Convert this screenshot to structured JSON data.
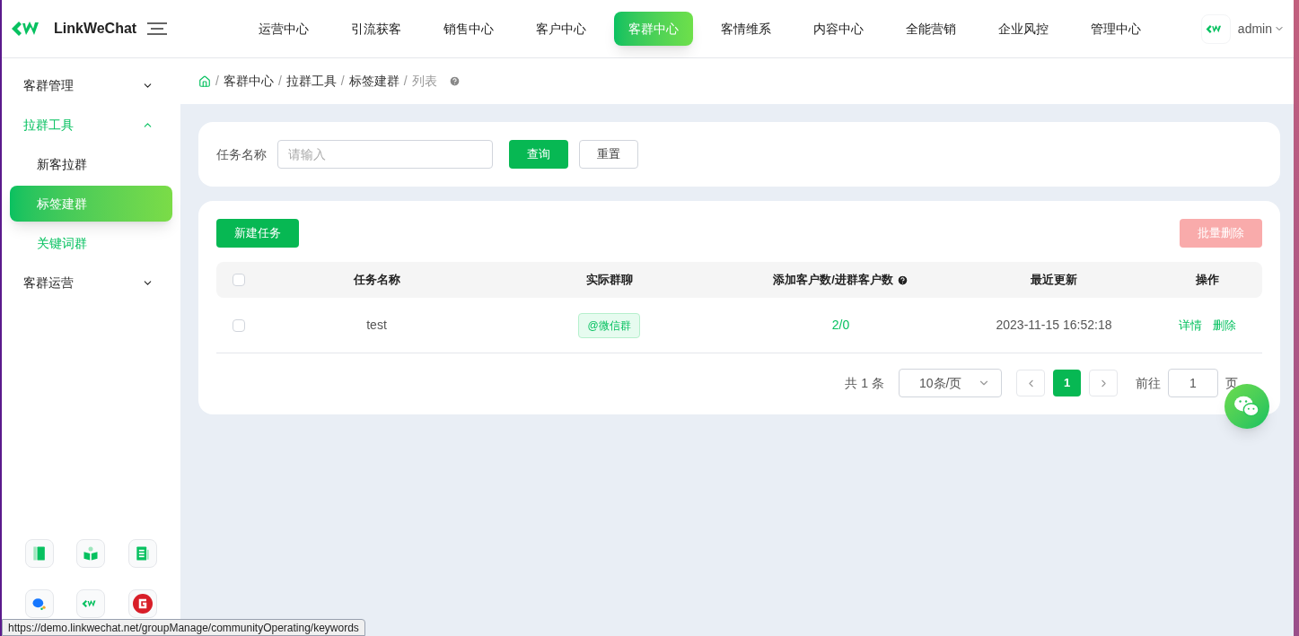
{
  "brand": {
    "name": "LinkWeChat"
  },
  "top_nav": [
    {
      "label": "运营中心",
      "selected": false
    },
    {
      "label": "引流获客",
      "selected": false
    },
    {
      "label": "销售中心",
      "selected": false
    },
    {
      "label": "客户中心",
      "selected": false
    },
    {
      "label": "客群中心",
      "selected": true
    },
    {
      "label": "客情维系",
      "selected": false
    },
    {
      "label": "内容中心",
      "selected": false
    },
    {
      "label": "全能营销",
      "selected": false
    },
    {
      "label": "企业风控",
      "selected": false
    },
    {
      "label": "管理中心",
      "selected": false
    }
  ],
  "user": {
    "name": "admin"
  },
  "sidebar": {
    "items": [
      {
        "label": "客群管理",
        "expanded": false,
        "active": false
      },
      {
        "label": "拉群工具",
        "expanded": true,
        "active": true,
        "children": [
          {
            "label": "新客拉群",
            "selected": false,
            "hovered": false
          },
          {
            "label": "标签建群",
            "selected": true,
            "hovered": false
          },
          {
            "label": "关键词群",
            "selected": false,
            "hovered": true
          }
        ]
      },
      {
        "label": "客群运营",
        "expanded": false,
        "active": false
      }
    ]
  },
  "breadcrumb": [
    "客群中心",
    "拉群工具",
    "标签建群",
    "列表"
  ],
  "breadcrumb_separator": "/",
  "search": {
    "label": "任务名称",
    "placeholder": "请输入",
    "buttons": [
      "查询",
      "重置"
    ]
  },
  "toolbar": {
    "create": "新建任务",
    "batch_delete": {
      "label": "批量删除",
      "disabled": true
    }
  },
  "table": {
    "columns": [
      {
        "label": "任务名称"
      },
      {
        "label": "实际群聊"
      },
      {
        "label": "添加客户数/进群客户数",
        "help": true
      },
      {
        "label": "最近更新"
      },
      {
        "label": "操作"
      }
    ],
    "all_checked": false,
    "rows": [
      {
        "checked": false,
        "name": "test",
        "group": "@微信群",
        "counts": "2/0",
        "updated": "2023-11-15 16:52:18",
        "actions": [
          "详情",
          "删除"
        ]
      }
    ]
  },
  "pagination": {
    "total": "共 1 条",
    "page_size": "10条/页",
    "pages": [
      {
        "label": "1",
        "selected": true
      }
    ],
    "goto_label": "前往",
    "goto_value": "1",
    "goto_suffix": "页"
  },
  "status_url": "https://demo.linkwechat.net/groupManage/communityOperating/keywords"
}
